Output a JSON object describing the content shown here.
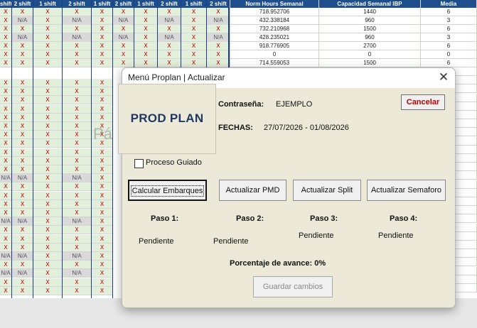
{
  "sheet": {
    "headers": [
      "shift",
      "2 shift",
      "1 shift",
      "2 shift",
      "1 shift",
      "2 shift",
      "1 shift",
      "2 shift",
      "1 shift",
      "2 shift",
      "Norm Hours Semanal",
      "Capacidad Semanal IBP",
      "Media"
    ],
    "rows": [
      {
        "cells": [
          "X",
          "X",
          "X",
          "X",
          "X",
          "X",
          "X",
          "X",
          "X",
          "X"
        ],
        "norm": "718.952706",
        "cap": "1440",
        "media": "6"
      },
      {
        "cells": [
          "X",
          "N/A",
          "X",
          "N/A",
          "X",
          "N/A",
          "X",
          "N/A",
          "X",
          "N/A"
        ],
        "norm": "432.338184",
        "cap": "960",
        "media": "3"
      },
      {
        "cells": [
          "X",
          "X",
          "X",
          "X",
          "X",
          "X",
          "X",
          "X",
          "X",
          "X"
        ],
        "norm": "732.210968",
        "cap": "1500",
        "media": "6"
      },
      {
        "cells": [
          "X",
          "N/A",
          "X",
          "N/A",
          "X",
          "N/A",
          "X",
          "N/A",
          "X",
          "N/A"
        ],
        "norm": "428.235021",
        "cap": "960",
        "media": "3"
      },
      {
        "cells": [
          "X",
          "X",
          "X",
          "X",
          "X",
          "X",
          "X",
          "X",
          "X",
          "X"
        ],
        "norm": "918.776905",
        "cap": "2700",
        "media": "6"
      },
      {
        "cells": [
          "X",
          "X",
          "X",
          "X",
          "X",
          "X",
          "X",
          "X",
          "X",
          "X"
        ],
        "norm": "0",
        "cap": "0",
        "media": "0"
      },
      {
        "cells": [
          "X",
          "X",
          "X",
          "X",
          "X",
          "X",
          "X",
          "X",
          "X",
          "X"
        ],
        "norm": "714.559053",
        "cap": "1500",
        "media": "6"
      }
    ],
    "left_rows": [
      [
        "X",
        "X",
        "X",
        "X",
        "X"
      ],
      [
        "X",
        "X",
        "X",
        "X",
        "X"
      ],
      [
        "X",
        "X",
        "X",
        "X",
        "X"
      ],
      [
        "X",
        "X",
        "X",
        "X",
        "X"
      ],
      [
        "X",
        "X",
        "X",
        "X",
        "X"
      ],
      [
        "X",
        "X",
        "X",
        "X",
        "X"
      ],
      [
        "X",
        "X",
        "X",
        "X",
        "X"
      ],
      [
        "X",
        "X",
        "X",
        "X",
        "X"
      ],
      [
        "X",
        "X",
        "X",
        "X",
        "X"
      ],
      [
        "X",
        "X",
        "X",
        "X",
        "X"
      ],
      [
        "X",
        "X",
        "X",
        "X",
        "X"
      ],
      [
        "N/A",
        "N/A",
        "X",
        "N/A",
        "X"
      ],
      [
        "X",
        "X",
        "X",
        "X",
        "X"
      ],
      [
        "X",
        "X",
        "X",
        "X",
        "X"
      ],
      [
        "X",
        "X",
        "X",
        "X",
        "X"
      ],
      [
        "X",
        "X",
        "X",
        "X",
        "X"
      ],
      [
        "N/A",
        "N/A",
        "X",
        "N/A",
        "X"
      ],
      [
        "X",
        "X",
        "X",
        "X",
        "X"
      ],
      [
        "X",
        "X",
        "X",
        "X",
        "X"
      ],
      [
        "X",
        "X",
        "X",
        "X",
        "X"
      ],
      [
        "N/A",
        "N/A",
        "X",
        "N/A",
        "X"
      ],
      [
        "X",
        "X",
        "X",
        "X",
        "X"
      ],
      [
        "N/A",
        "N/A",
        "X",
        "N/A",
        "X"
      ],
      [
        "X",
        "X",
        "X",
        "X",
        "X"
      ],
      [
        "X",
        "X",
        "X",
        "X",
        "X"
      ]
    ],
    "watermark": "Pá"
  },
  "dialog": {
    "title": "Menú Proplan | Actualizar",
    "close_glyph": "✕",
    "logo": "PROD PLAN",
    "password_label": "Contraseña:",
    "password_value": "EJEMPLO",
    "dates_label": "FECHAS:",
    "dates_value": "27/07/2026 - 01/08/2026",
    "cancel_label": "Cancelar",
    "guided_label": "Proceso Guiado",
    "guided_checked": false,
    "buttons": {
      "embarques": "Calcular Embarques",
      "pmd": "Actualizar PMD",
      "split": "Actualizar Split",
      "semaforo": "Actualizar Semaforo"
    },
    "steps": [
      {
        "label": "Paso 1:",
        "status": "Pendiente"
      },
      {
        "label": "Paso 2:",
        "status": "Pendiente"
      },
      {
        "label": "Paso 3:",
        "status": "Pendiente"
      },
      {
        "label": "Paso 4:",
        "status": "Pendiente"
      }
    ],
    "progress_text": "Porcentaje de avance: 0%",
    "save_label": "Guardar cambios",
    "colors": {
      "cancel_text": "#c00000",
      "logo_text": "#1f3864",
      "header_bg": "#1f4e8c"
    }
  }
}
